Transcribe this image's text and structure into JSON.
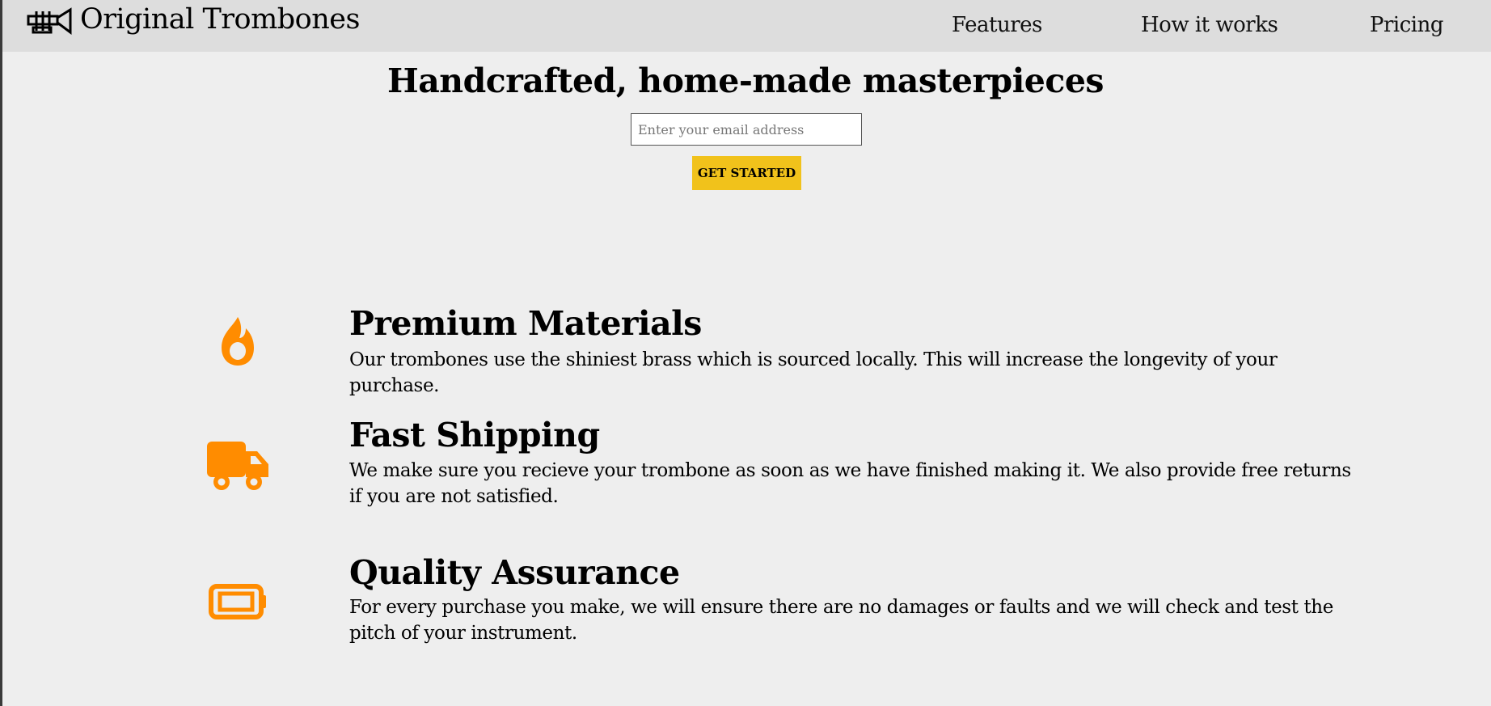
{
  "header": {
    "brand": "Original Trombones",
    "logo_icon": "trumpet-icon",
    "nav": [
      {
        "label": "Features"
      },
      {
        "label": "How it works"
      },
      {
        "label": "Pricing"
      }
    ]
  },
  "hero": {
    "title": "Handcrafted, home-made masterpieces",
    "email_placeholder": "Enter your email address",
    "cta_label": "GET STARTED"
  },
  "features": [
    {
      "icon": "fire-icon",
      "title": "Premium Materials",
      "description": "Our trombones use the shiniest brass which is sourced locally. This will increase the longevity of your purchase."
    },
    {
      "icon": "truck-icon",
      "title": "Fast Shipping",
      "description": "We make sure you recieve your trombone as soon as we have finished making it. We also provide free returns if you are not satisfied."
    },
    {
      "icon": "battery-icon",
      "title": "Quality Assurance",
      "description": "For every purchase you make, we will ensure there are no damages or faults and we will check and test the pitch of your instrument."
    }
  ],
  "colors": {
    "accent": "#ff8c00",
    "cta": "#f1c21b",
    "header_bg": "#dddddd",
    "page_bg": "#eeeeee"
  }
}
